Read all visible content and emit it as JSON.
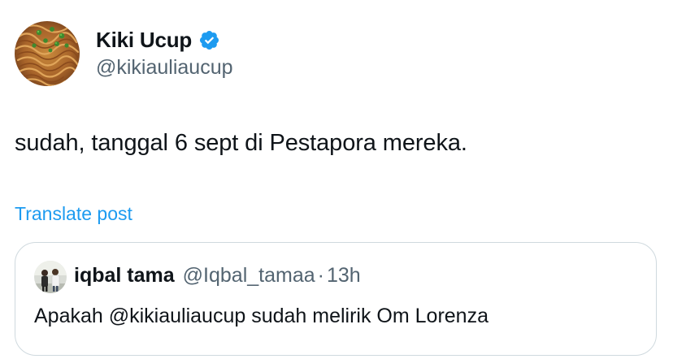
{
  "author": {
    "name": "Kiki Ucup",
    "handle": "@kikiauliaucup",
    "verified": true
  },
  "post": {
    "text": "sudah, tanggal 6 sept di Pestapora mereka.",
    "translate_label": "Translate post"
  },
  "quoted_post": {
    "name": "iqbal tama",
    "handle": "@Iqbal_tamaa",
    "separator": "·",
    "time": "13h",
    "text": "Apakah @kikiauliaucup sudah melirik Om Lorenza"
  },
  "colors": {
    "link_blue": "#1d9bf0",
    "verified_blue": "#1d9bf0",
    "secondary_text": "#536471",
    "primary_text": "#0f1419",
    "border": "#cfd9de"
  }
}
